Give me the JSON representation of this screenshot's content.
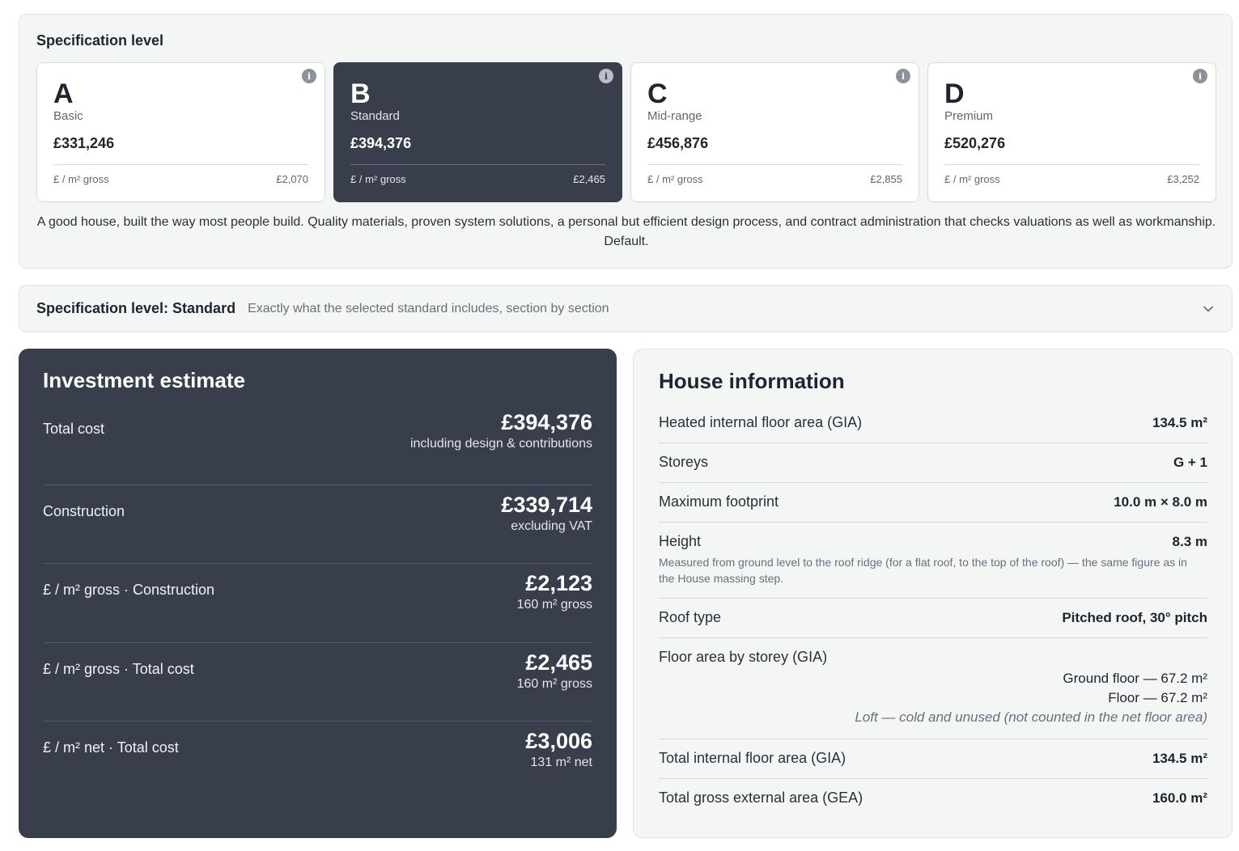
{
  "spec": {
    "title": "Specification level",
    "cards": [
      {
        "letter": "A",
        "name": "Basic",
        "price": "£331,246",
        "rate_label": "£ / m² gross",
        "rate": "£2,070"
      },
      {
        "letter": "B",
        "name": "Standard",
        "price": "£394,376",
        "rate_label": "£ / m² gross",
        "rate": "£2,465"
      },
      {
        "letter": "C",
        "name": "Mid-range",
        "price": "£456,876",
        "rate_label": "£ / m² gross",
        "rate": "£2,855"
      },
      {
        "letter": "D",
        "name": "Premium",
        "price": "£520,276",
        "rate_label": "£ / m² gross",
        "rate": "£3,252"
      }
    ],
    "selected": "B",
    "description": "A good house, built the way most people build. Quality materials, proven system solutions, a personal but efficient design process, and contract administration that checks valuations as well as workmanship. Default."
  },
  "accordion": {
    "title": "Specification level: Standard",
    "subtitle": "Exactly what the selected standard includes, section by section"
  },
  "investment": {
    "title": "Investment estimate",
    "rows": [
      {
        "label": "Total cost",
        "value": "£394,376",
        "sub": "including design & contributions"
      },
      {
        "label": "Construction",
        "value": "£339,714",
        "sub": "excluding VAT"
      },
      {
        "label": "£ / m² gross · Construction",
        "value": "£2,123",
        "sub": "160 m² gross"
      },
      {
        "label": "£ / m² gross · Total cost",
        "value": "£2,465",
        "sub": "160 m² gross"
      },
      {
        "label": "£ / m² net · Total cost",
        "value": "£3,006",
        "sub": "131 m² net"
      }
    ]
  },
  "house": {
    "title": "House information",
    "gia": {
      "label": "Heated internal floor area (GIA)",
      "value": "134.5 m²"
    },
    "storeys": {
      "label": "Storeys",
      "value": "G + 1"
    },
    "footprint": {
      "label": "Maximum footprint",
      "value": "10.0 m × 8.0 m"
    },
    "height": {
      "label": "Height",
      "value": "8.3 m",
      "note": "Measured from ground level to the roof ridge (for a flat roof, to the top of the roof) — the same figure as in the House massing step."
    },
    "roof": {
      "label": "Roof type",
      "value": "Pitched roof, 30° pitch"
    },
    "floor_area": {
      "label": "Floor area by storey (GIA)",
      "lines": [
        "Ground floor — 67.2 m²",
        "Floor — 67.2 m²",
        "Loft — cold and unused (not counted in the net floor area)"
      ]
    },
    "total_gia": {
      "label": "Total internal floor area (GIA)",
      "value": "134.5 m²"
    },
    "gea": {
      "label": "Total gross external area (GEA)",
      "value": "160.0 m²"
    }
  },
  "icons": {
    "info": "info-icon",
    "chevron": "chevron-down-icon"
  },
  "colors": {
    "dark": "#383e4c",
    "panel": "#f4f5f5"
  }
}
